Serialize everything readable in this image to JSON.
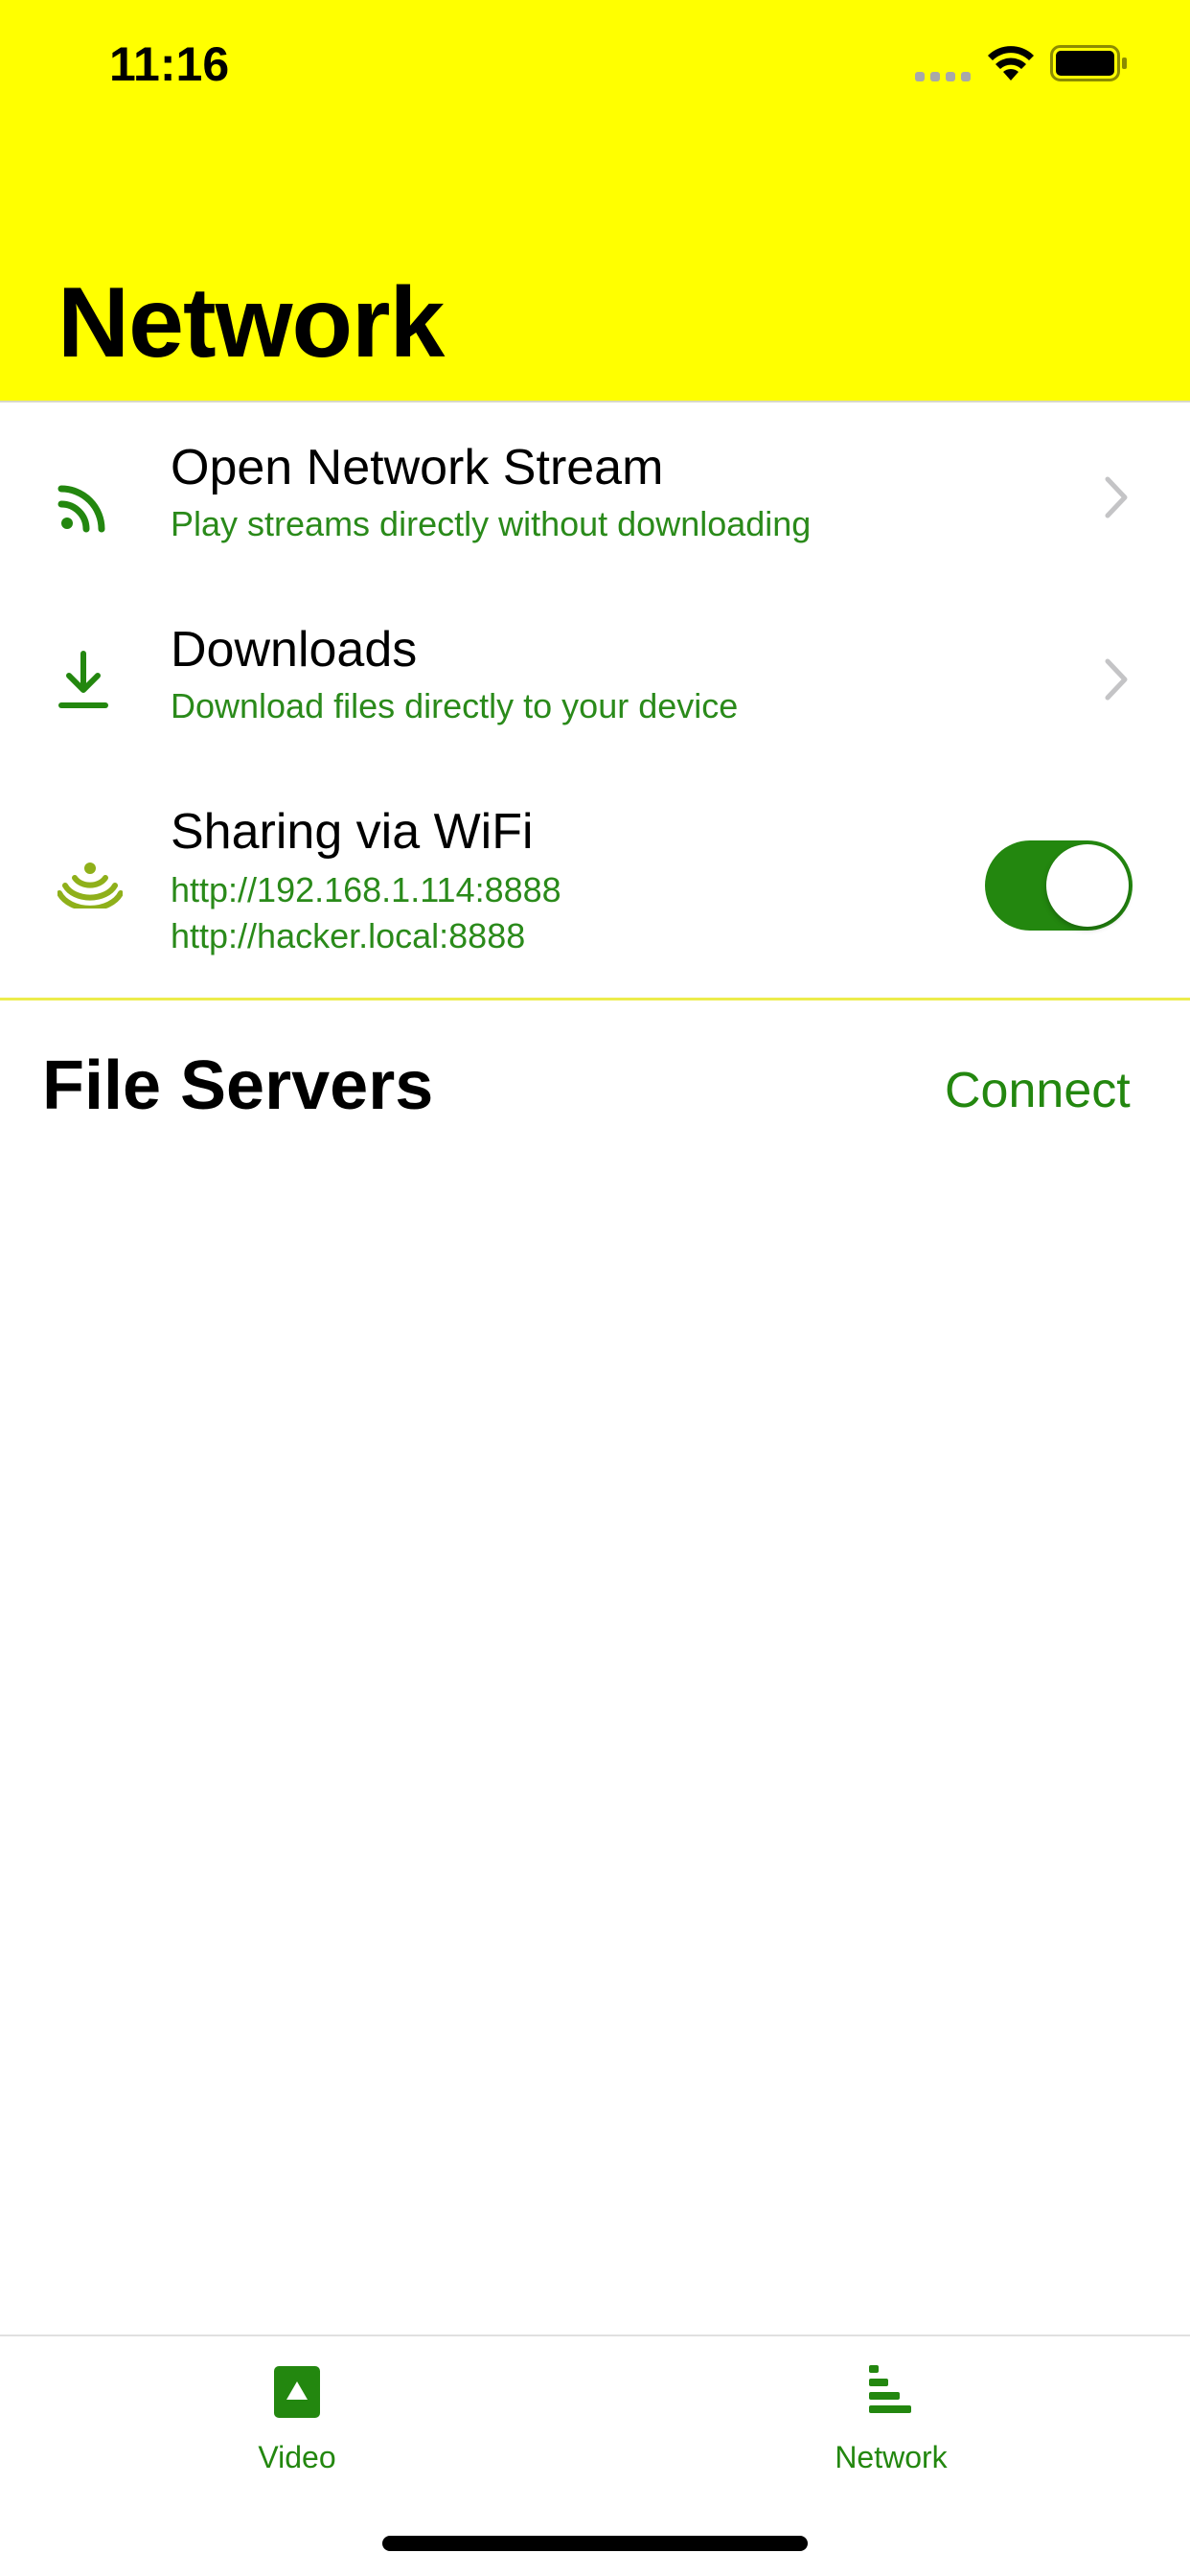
{
  "status_bar": {
    "time": "11:16"
  },
  "header": {
    "title": "Network",
    "background_color": "#ffff00"
  },
  "rows": [
    {
      "icon": "network-stream-icon",
      "title": "Open Network Stream",
      "subtitle": "Play streams directly without downloading"
    },
    {
      "icon": "download-icon",
      "title": "Downloads",
      "subtitle": "Download files directly to your device"
    },
    {
      "icon": "wifi-sharing-icon",
      "title": "Sharing via WiFi",
      "subtitle_line1": "http://192.168.1.114:8888",
      "subtitle_line2": "http://hacker.local:8888",
      "toggle_on": true
    }
  ],
  "file_servers": {
    "title": "File Servers",
    "connect_label": "Connect"
  },
  "tabbar": {
    "tabs": [
      {
        "label": "Video",
        "icon": "video-icon"
      },
      {
        "label": "Network",
        "icon": "network-tab-icon"
      }
    ]
  },
  "colors": {
    "accent": "#23870f",
    "subtitle": "#2a8a1a",
    "separator": "#ecec4c"
  }
}
